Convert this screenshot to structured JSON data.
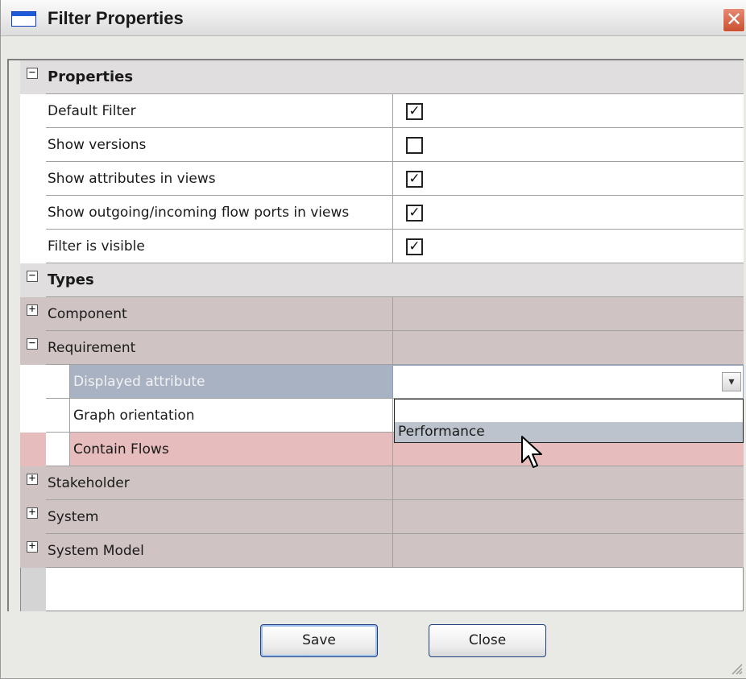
{
  "window": {
    "title": "Filter Properties",
    "close_glyph": "✕"
  },
  "sections": {
    "properties": {
      "label": "Properties",
      "toggle": "−"
    },
    "types": {
      "label": "Types",
      "toggle": "−"
    }
  },
  "properties": [
    {
      "label": "Default Filter",
      "checked": true,
      "mark": "✓"
    },
    {
      "label": "Show versions",
      "checked": false,
      "mark": ""
    },
    {
      "label": "Show attributes in views",
      "checked": true,
      "mark": "✓"
    },
    {
      "label": "Show outgoing/incoming flow ports in views",
      "checked": true,
      "mark": "✓"
    },
    {
      "label": "Filter is visible",
      "checked": true,
      "mark": "✓"
    }
  ],
  "types": {
    "component": {
      "label": "Component",
      "toggle": "+"
    },
    "requirement": {
      "label": "Requirement",
      "toggle": "−",
      "children": {
        "displayed_attribute": {
          "label": "Displayed attribute",
          "value": ""
        },
        "graph_orientation": {
          "label": "Graph orientation"
        },
        "contain_flows": {
          "label": "Contain Flows"
        }
      }
    },
    "stakeholder": {
      "label": "Stakeholder",
      "toggle": "+"
    },
    "system": {
      "label": "System",
      "toggle": "+"
    },
    "system_model": {
      "label": "System Model",
      "toggle": "+"
    }
  },
  "dropdown": {
    "options": [
      "",
      "Performance"
    ],
    "highlighted": "Performance",
    "arrow": "▾"
  },
  "buttons": {
    "save": "Save",
    "close": "Close"
  },
  "colors": {
    "selected_row": "#a9b2c2",
    "contain_flows_row": "#e6bcbc",
    "type_row": "#cfc3c3",
    "dropdown_highlight": "#bcc3cc"
  }
}
